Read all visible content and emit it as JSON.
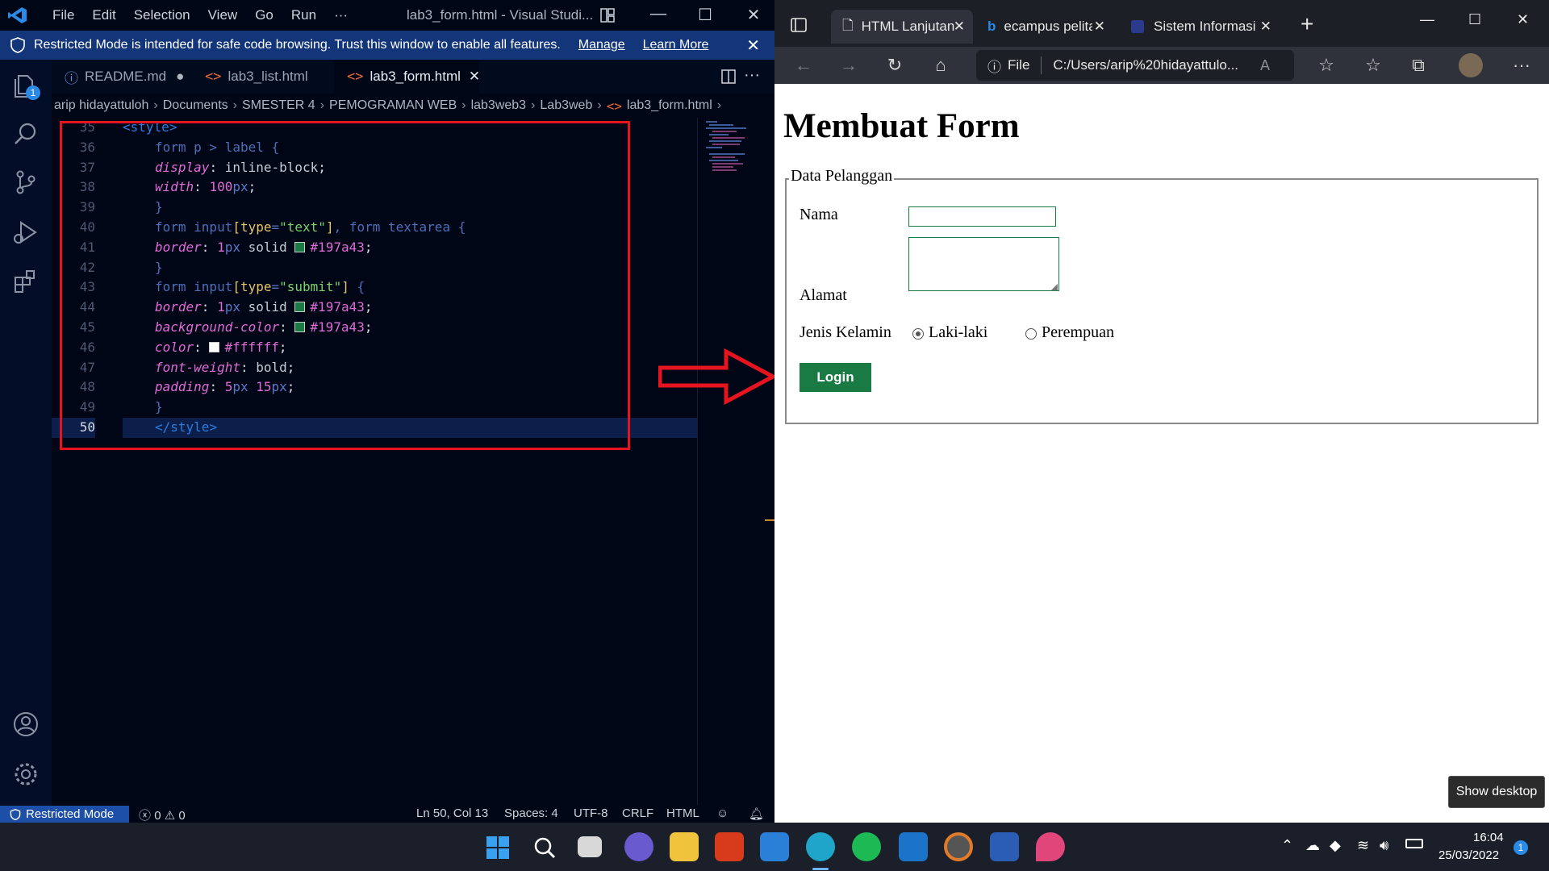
{
  "vscode": {
    "menu": [
      "File",
      "Edit",
      "Selection",
      "View",
      "Go",
      "Run",
      "···"
    ],
    "window_title": "lab3_form.html - Visual Studi...",
    "banner": {
      "text": "Restricted Mode is intended for safe code browsing. Trust this window to enable all features.",
      "manage": "Manage",
      "learn_more": "Learn More"
    },
    "activity_badge": "1",
    "tabs": [
      {
        "label": "README.md",
        "icon": "info-icon"
      },
      {
        "label": "lab3_list.html",
        "icon": "html-icon"
      },
      {
        "label": "lab3_form.html",
        "icon": "html-icon",
        "active": true
      }
    ],
    "breadcrumb": [
      "arip hidayattuloh",
      "Documents",
      "SMESTER 4",
      "PEMOGRAMAN WEB",
      "lab3web3",
      "Lab3web",
      "lab3_form.html"
    ],
    "code": {
      "line_numbers": [
        "35",
        "36",
        "37",
        "38",
        "39",
        "40",
        "41",
        "42",
        "43",
        "44",
        "45",
        "46",
        "47",
        "48",
        "49",
        "50"
      ],
      "l35": {
        "open": "<",
        "tag": "style",
        "close": ">"
      },
      "l36": {
        "sel": "form p > label",
        "brace": " {"
      },
      "l37": {
        "prop": "display",
        "val": "inline-block"
      },
      "l38": {
        "prop": "width",
        "num": "100",
        "unit": "px"
      },
      "l39": "}",
      "l40": {
        "a": "form input",
        "b": "type",
        "c": "\"text\"",
        "d": "form textarea"
      },
      "l41": {
        "prop": "border",
        "num": "1",
        "unit": "px",
        "val": "solid",
        "hex": "#197a43"
      },
      "l42": "}",
      "l43": {
        "a": "form input",
        "b": "type",
        "c": "\"submit\""
      },
      "l44": {
        "prop": "border",
        "num": "1",
        "unit": "px",
        "val": "solid",
        "hex": "#197a43"
      },
      "l45": {
        "prop": "background-color",
        "hex": "#197a43"
      },
      "l46": {
        "prop": "color",
        "hex": "#ffffff"
      },
      "l47": {
        "prop": "font-weight",
        "val": "bold"
      },
      "l48": {
        "prop": "padding",
        "num1": "5",
        "unit1": "px",
        "num2": "15",
        "unit2": "px"
      },
      "l49": "}",
      "l50": {
        "open": "</",
        "tag": "style",
        "close": ">"
      }
    },
    "status": {
      "restricted": "Restricted Mode",
      "errors": "0",
      "warnings": "0",
      "position": "Ln 50, Col 13",
      "spaces": "Spaces: 4",
      "encoding": "UTF-8",
      "eol": "CRLF",
      "language": "HTML"
    }
  },
  "edge": {
    "tabs": [
      {
        "label": "HTML Lanjutan",
        "active": true
      },
      {
        "label": "ecampus pelita b"
      },
      {
        "label": "Sistem Informasi"
      }
    ],
    "address": {
      "scheme": "File",
      "url": "C:/Users/arip%20hidayattulo..."
    },
    "page": {
      "title": "Membuat Form",
      "legend": "Data Pelanggan",
      "nama_label": "Nama",
      "alamat_label": "Alamat",
      "gender_label": "Jenis Kelamin",
      "gender_options": [
        "Laki-laki",
        "Perempuan"
      ],
      "gender_selected": "Laki-laki",
      "submit": "Login"
    },
    "show_desktop": "Show desktop"
  },
  "taskbar": {
    "time": "16:04",
    "date": "25/03/2022",
    "notification_count": "1"
  },
  "colors": {
    "accent_green": "#197a43",
    "highlight_red": "#e5141e",
    "vscode_bg": "#010617",
    "banner_blue": "#13357a"
  }
}
